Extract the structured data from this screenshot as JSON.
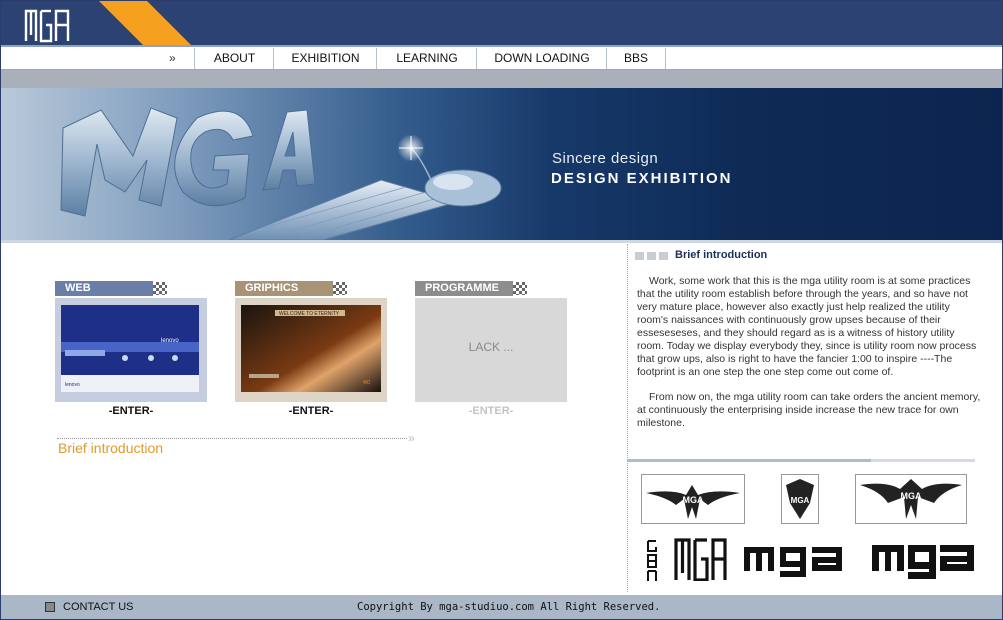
{
  "header": {
    "logo_text": "MGA",
    "logo_icon": "mga-logo-icon"
  },
  "nav": {
    "arrows": "»",
    "items": [
      {
        "label": "ABOUT"
      },
      {
        "label": "EXHIBITION"
      },
      {
        "label": "LEARNING"
      },
      {
        "label": "DOWN LOADING"
      },
      {
        "label": "BBS"
      }
    ]
  },
  "banner": {
    "brand": "MGA",
    "slogan_small": "Sincere design",
    "slogan_big": "DESIGN EXHIBITION"
  },
  "cards": [
    {
      "title": "WEB",
      "action": "-ENTER-",
      "color": "#6b7ea8"
    },
    {
      "title": "GRIPHICS",
      "action": "-ENTER-",
      "color": "#a89377"
    },
    {
      "title": "PROGRAMME",
      "action": "-ENTER-",
      "placeholder": "LACK ...",
      "color": "#8d8d8d"
    }
  ],
  "web_thumb": {
    "brand": "lenovo",
    "subbrand": "lenovo"
  },
  "griphics_thumb": {
    "heading": "WELCOME TO ETERNITY",
    "tag": "4/0"
  },
  "left_link": {
    "label": "Brief introduction",
    "arrows": "»"
  },
  "intro": {
    "title": "Brief introduction",
    "paragraph1": "Work, some work that this is the mga utility room is at some practices that the utility room establish before through the years, and so have not very mature place, however also exactly just help realized the utility room's naissances with continuously grow upses because of their esseseseses, and they should regard as is a witness of history utility room. Today we display everybody they, since is utility room now process that grow ups, also is right to have the fancier 1:00 to inspire ----The footprint is an one step the one step come out come of.",
    "paragraph2": "From now on, the mga utility room can take orders the ancient memory, at continuously the enterprising inside increase the new trace for own milestone."
  },
  "logos": [
    {
      "text": "MGA",
      "icon": "mga-tribal-logo-icon"
    },
    {
      "text": "MGA",
      "icon": "mga-badge-logo-icon"
    },
    {
      "text": "MGA",
      "icon": "mga-wide-tribal-logo-icon"
    },
    {
      "text": "mga",
      "icon": "mga-vertical-logo-icon"
    },
    {
      "text": "MGA",
      "icon": "mga-block-logo-icon"
    },
    {
      "text": "mga",
      "icon": "mga-wordmark-icon"
    },
    {
      "text": "mga",
      "icon": "mga-wordmark-bold-icon"
    }
  ],
  "footer": {
    "contact": "CONTACT US",
    "copyright": "Copyright By mga-studiuo.com All Right Reserved."
  },
  "colors": {
    "header": "#2c4272",
    "accent": "#f5a01f",
    "link_orange": "#e39a2c",
    "footer": "#a9b7c6"
  }
}
